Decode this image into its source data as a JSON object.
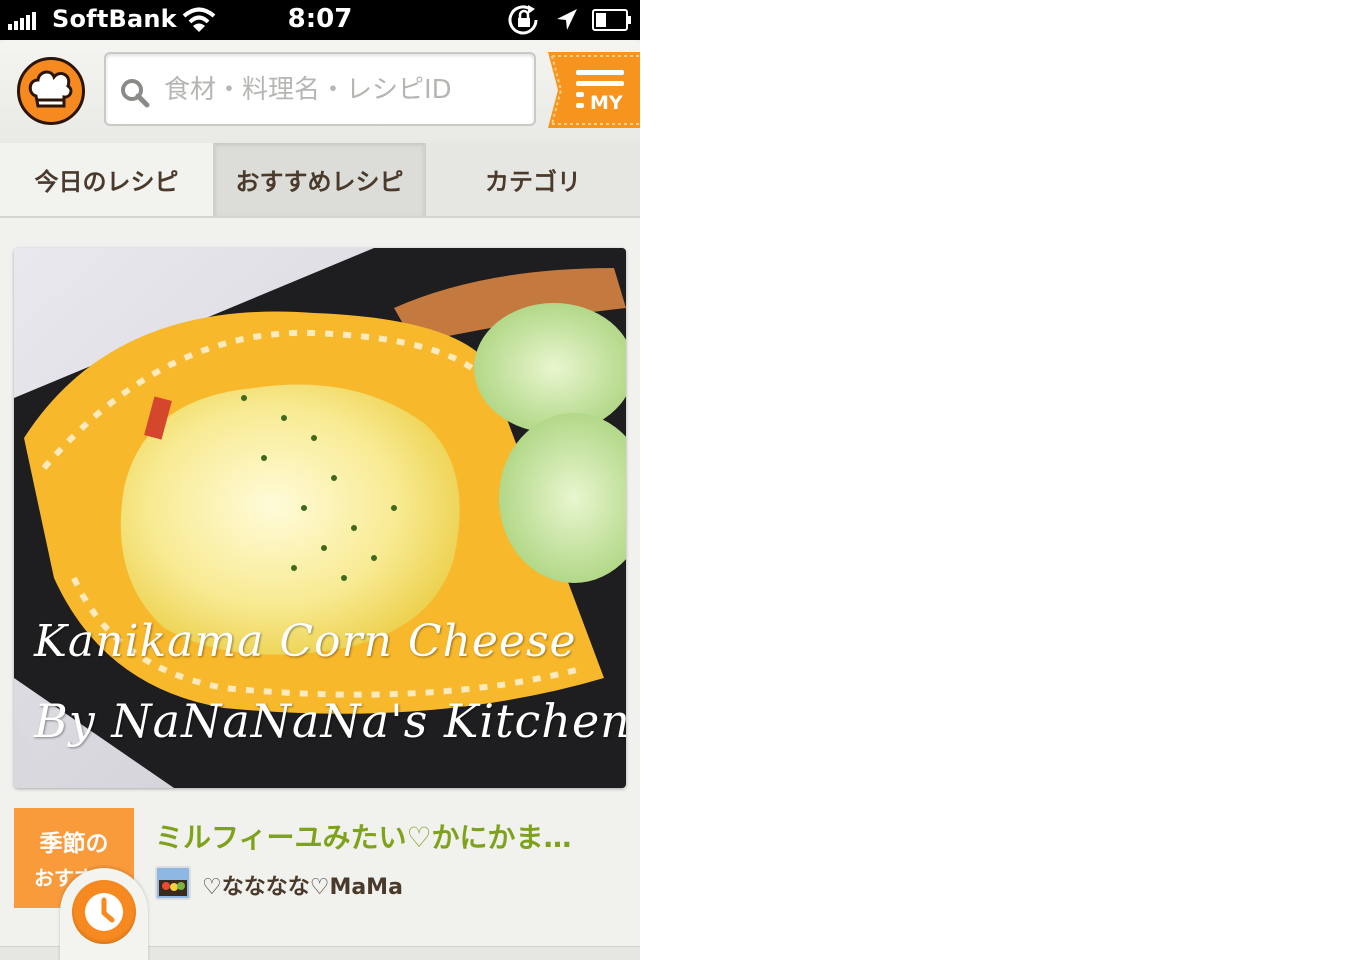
{
  "status_bar": {
    "carrier": "SoftBank",
    "time": "8:07"
  },
  "header": {
    "search": {
      "placeholder": "食材・料理名・レシピID",
      "value": ""
    },
    "my_label": "MY"
  },
  "tabs": [
    {
      "label": "今日のレシピ"
    },
    {
      "label": "おすすめレシピ",
      "selected": true
    },
    {
      "label": "カテゴリ"
    }
  ],
  "feature": {
    "caption_line1": "Kanikama Corn Cheese",
    "caption_line2": "By NaNaNaNa's Kitchen",
    "badge_line1": "季節の",
    "badge_line2": "おすすめ",
    "recipe_title": "ミルフィーユみたい♡かにかま…",
    "author": "♡なななな♡MaMa"
  },
  "colors": {
    "brand_orange": "#f6891f",
    "title_green": "#7ea21a",
    "badge_orange": "#f99a3b"
  },
  "icons": [
    "chef-hat-logo-icon",
    "search-icon",
    "menu-icon",
    "clock-icon",
    "wifi-icon",
    "rotation-lock-icon",
    "location-arrow-icon",
    "battery-icon"
  ]
}
